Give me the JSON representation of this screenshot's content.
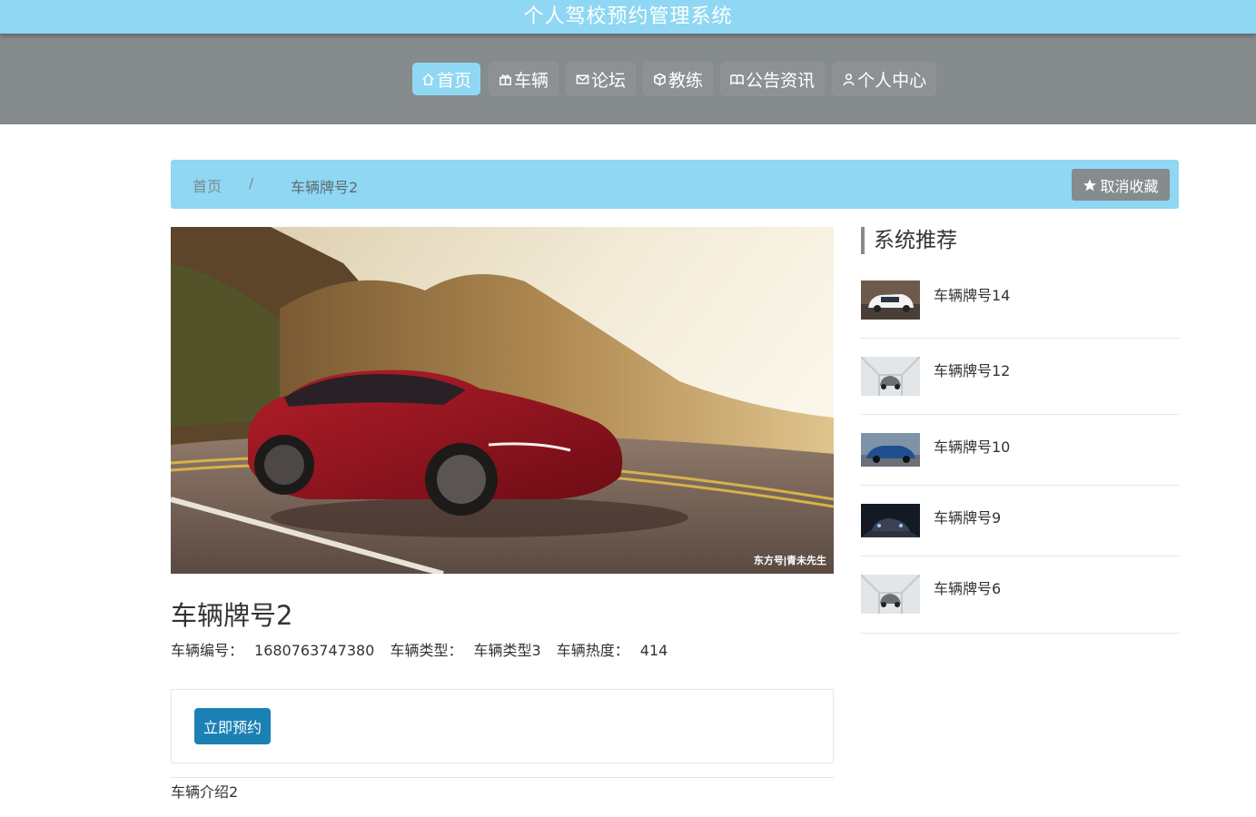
{
  "app": {
    "title": "个人驾校预约管理系统"
  },
  "nav": [
    {
      "label": "首页",
      "icon": "home-icon",
      "active": true
    },
    {
      "label": "车辆",
      "icon": "gift-icon"
    },
    {
      "label": "论坛",
      "icon": "mail-icon"
    },
    {
      "label": "教练",
      "icon": "cube-icon"
    },
    {
      "label": "公告资讯",
      "icon": "book-icon"
    },
    {
      "label": "个人中心",
      "icon": "user-icon"
    }
  ],
  "breadcrumb": {
    "home": "首页",
    "separator": "/",
    "current": "车辆牌号2"
  },
  "favorite": {
    "label": "取消收藏",
    "icon": "star-icon"
  },
  "hero": {
    "watermark": "东方号|青未先生"
  },
  "detail": {
    "title": "车辆牌号2",
    "code_label": "车辆编号：",
    "code_value": "1680763747380",
    "type_label": "车辆类型：",
    "type_value": "车辆类型3",
    "heat_label": "车辆热度：",
    "heat_value": "414"
  },
  "book": {
    "label": "立即预约"
  },
  "intro": {
    "text": "车辆介绍2"
  },
  "sidebar": {
    "title": "系统推荐",
    "items": [
      {
        "name": "车辆牌号14"
      },
      {
        "name": "车辆牌号12"
      },
      {
        "name": "车辆牌号10"
      },
      {
        "name": "车辆牌号9"
      },
      {
        "name": "车辆牌号6"
      }
    ]
  },
  "colors": {
    "accent": "#8fd7f2",
    "nav_bg": "#868b8d",
    "button_blue": "#1b80b4"
  }
}
